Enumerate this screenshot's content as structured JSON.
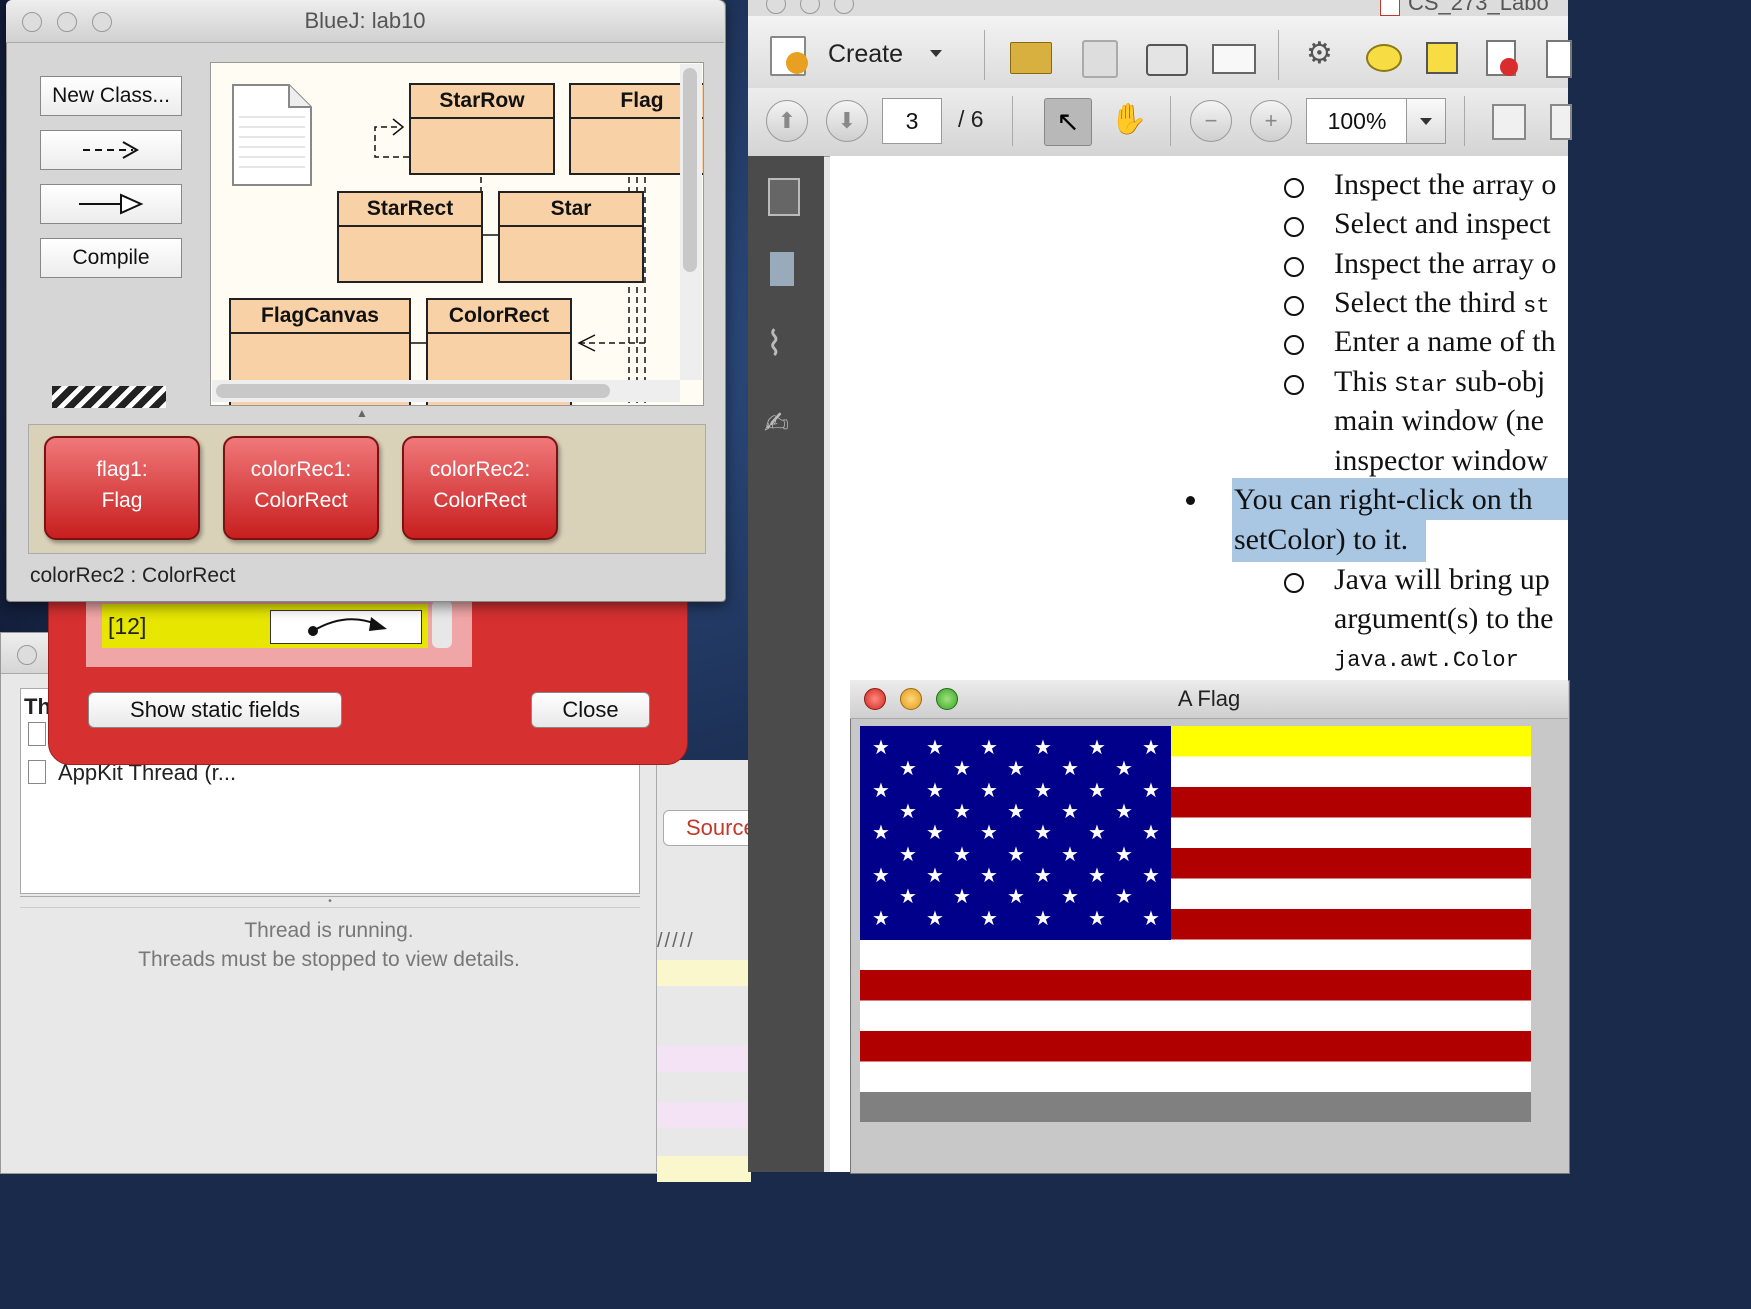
{
  "debugger": {
    "header_text": "Th",
    "threads": [
      "AppKit Thread (r..."
    ],
    "message_line1": "Thread is running.",
    "message_line2": "Threads must be stopped to view details."
  },
  "editor_strip": {
    "source_tab": "Source",
    "hatch_text": "/////"
  },
  "inspector": {
    "field_index": "[12]",
    "show_static_label": "Show static fields",
    "close_label": "Close"
  },
  "bluej": {
    "title": "BlueJ:  lab10",
    "buttons": {
      "new_class": "New Class...",
      "dependency_arrow": "- - ->",
      "inheritance_arrow": "——▷",
      "compile": "Compile"
    },
    "classes": [
      "StarRow",
      "Flag",
      "StarRect",
      "Star",
      "FlagCanvas",
      "ColorRect"
    ],
    "objects": [
      {
        "line1": "flag1:",
        "line2": "Flag"
      },
      {
        "line1": "colorRec1:",
        "line2": "ColorRect"
      },
      {
        "line1": "colorRec2:",
        "line2": "ColorRect"
      }
    ],
    "status": "colorRec2 : ColorRect"
  },
  "pdf": {
    "title": "CS_273_Labo",
    "create_label": "Create",
    "page_current": "3",
    "page_total": "/ 6",
    "zoom": "100%",
    "lines": [
      "Inspect the array o",
      "Select and inspect",
      "Inspect the array o",
      "Select the third",
      "Enter a name of th",
      "This",
      "main window (ne",
      "inspector window",
      "You can right-click on th",
      "setColor) to it.",
      "Java will bring up",
      "argument(s) to the",
      "java.awt.Color"
    ],
    "mono_fragments": {
      "line4": "st",
      "line6_code": "Star",
      "line6_rest": "sub-obj"
    }
  },
  "flag_window": {
    "title": "A Flag",
    "colors": {
      "blue": "#00008b",
      "red": "#b00000",
      "white": "#ffffff",
      "yellow": "#ffff00",
      "gray": "#808080"
    }
  }
}
